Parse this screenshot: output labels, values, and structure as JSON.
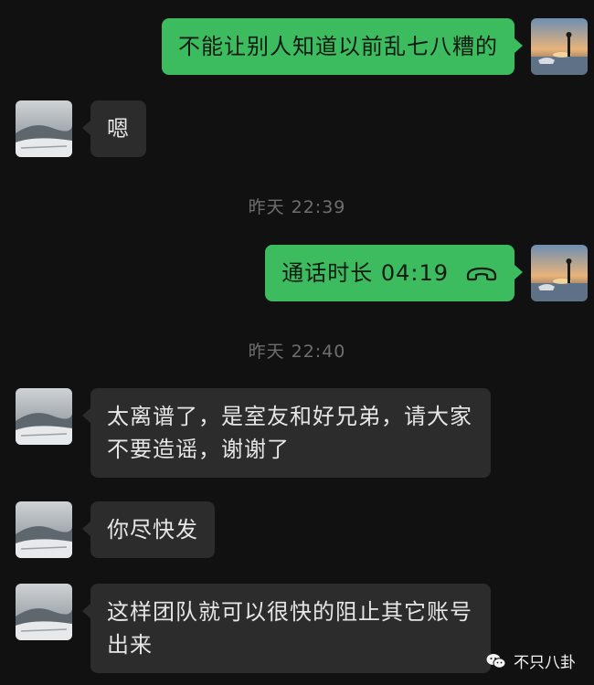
{
  "messages": [
    {
      "side": "out",
      "text": "不能让别人知道以前乱七八糟的"
    },
    {
      "side": "in",
      "text": "嗯"
    },
    {
      "side": "out",
      "type": "call",
      "text": "通话时长 04:19",
      "icon": "phone-hangup-icon"
    },
    {
      "side": "in",
      "text": "太离谱了，是室友和好兄弟，请大家不要造谣，谢谢了"
    },
    {
      "side": "in",
      "text": "你尽快发"
    },
    {
      "side": "in",
      "text": "这样团队就可以很快的阻止其它账号出来"
    }
  ],
  "timestamps": [
    "昨天 22:39",
    "昨天 22:40"
  ],
  "watermark": {
    "text": "不只八卦",
    "icon": "wechat-logo-icon"
  },
  "colors": {
    "background": "#111111",
    "outgoing_bubble": "#3dbb5f",
    "incoming_bubble": "#2c2c2c",
    "timestamp": "#6e6e6e"
  }
}
